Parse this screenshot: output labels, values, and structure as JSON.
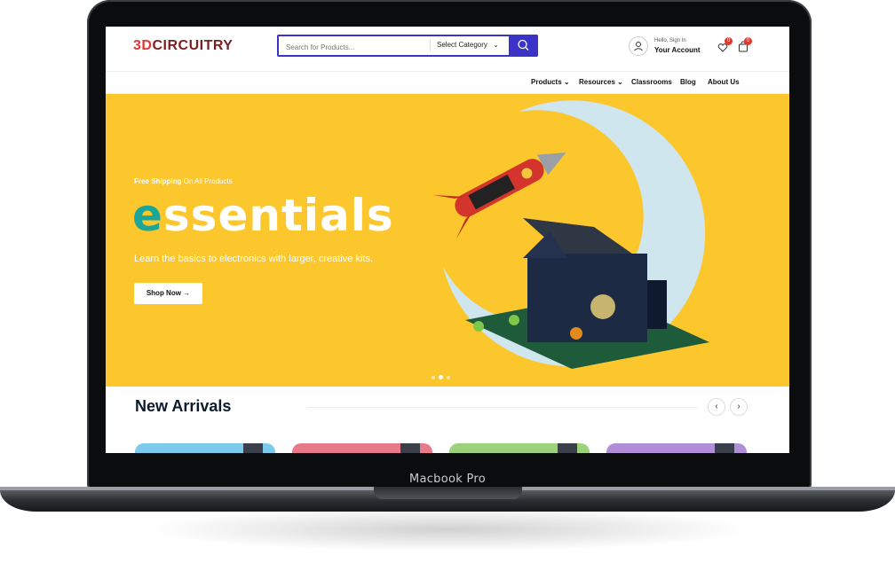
{
  "device": {
    "label": "Macbook Pro"
  },
  "header": {
    "logo_prefix": "3D",
    "logo_text": "CIRCUITRY",
    "search_placeholder": "Search for Products...",
    "category_label": "Select Category",
    "account_greeting": "Hello, Sign In",
    "account_label": "Your Account",
    "wishlist_count": "0",
    "cart_count": "0"
  },
  "nav": {
    "items": [
      {
        "label": "Products"
      },
      {
        "label": "Resources"
      },
      {
        "label": "Classrooms"
      },
      {
        "label": "Blog"
      },
      {
        "label": "About Us"
      }
    ]
  },
  "hero": {
    "shipping_bold": "Free Shipping",
    "shipping_rest": " On All Products",
    "title_accent": "e",
    "title_rest": "ssentials",
    "tagline": "Learn the basics to electronics with larger, creative kits.",
    "cta": "Shop Now",
    "cta_arrow": "→",
    "slides": 3,
    "active_slide": 2
  },
  "arrivals": {
    "title": "New Arrivals",
    "prev": "‹",
    "next": "›",
    "card_colors": [
      "#7ccaec",
      "#e8798a",
      "#9bd27a",
      "#b18fd8"
    ]
  },
  "colors": {
    "brand_blue": "#3b33c8",
    "brand_red": "#e5382d",
    "hero_yellow": "#fcc72c",
    "teal": "#1aa79a"
  }
}
